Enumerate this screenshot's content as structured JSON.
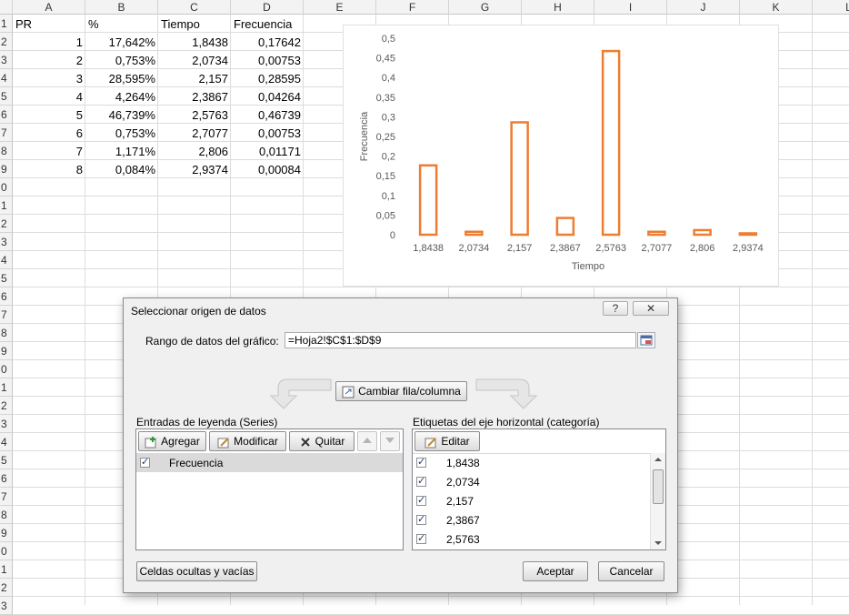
{
  "sheet": {
    "columns": [
      "A",
      "B",
      "C",
      "D",
      "E",
      "F",
      "G",
      "H",
      "I",
      "J",
      "K",
      "L"
    ],
    "rows": [
      "1",
      "2",
      "3",
      "4",
      "5",
      "6",
      "7",
      "8",
      "9",
      "0",
      "1",
      "2",
      "3",
      "4",
      "5",
      "6",
      "7",
      "8",
      "9",
      "0",
      "1",
      "2",
      "3",
      "4",
      "5",
      "6",
      "7",
      "8",
      "9",
      "0",
      "1",
      "2",
      "3"
    ],
    "headers": [
      "PR",
      "%",
      "Tiempo",
      "Frecuencia"
    ],
    "data": [
      [
        "1",
        "17,642%",
        "1,8438",
        "0,17642"
      ],
      [
        "2",
        "0,753%",
        "2,0734",
        "0,00753"
      ],
      [
        "3",
        "28,595%",
        "2,157",
        "0,28595"
      ],
      [
        "4",
        "4,264%",
        "2,3867",
        "0,04264"
      ],
      [
        "5",
        "46,739%",
        "2,5763",
        "0,46739"
      ],
      [
        "6",
        "0,753%",
        "2,7077",
        "0,00753"
      ],
      [
        "7",
        "1,171%",
        "2,806",
        "0,01171"
      ],
      [
        "8",
        "0,084%",
        "2,9374",
        "0,00084"
      ]
    ]
  },
  "chart_data": {
    "type": "bar",
    "categories": [
      "1,8438",
      "2,0734",
      "2,157",
      "2,3867",
      "2,5763",
      "2,7077",
      "2,806",
      "2,9374"
    ],
    "series": [
      {
        "name": "Frecuencia",
        "values": [
          0.17642,
          0.00753,
          0.28595,
          0.04264,
          0.46739,
          0.00753,
          0.01171,
          0.00084
        ]
      }
    ],
    "ytick_labels": [
      "0",
      "0,05",
      "0,1",
      "0,15",
      "0,2",
      "0,25",
      "0,3",
      "0,35",
      "0,4",
      "0,45",
      "0,5"
    ],
    "ylim": [
      0,
      0.5
    ],
    "xlabel": "Tiempo",
    "ylabel": "Frecuencia",
    "title": "",
    "grid": false,
    "bar_color": "#ed7d31"
  },
  "dialog": {
    "title": "Seleccionar origen de datos",
    "help_label": "?",
    "close_label": "✕",
    "range_label": "Rango de datos del gráfico:",
    "range_value": "=Hoja2!$C$1:$D$9",
    "switch_label": "Cambiar fila/columna",
    "legend_title": "Entradas de leyenda (Series)",
    "add_label": "Agregar",
    "edit_label": "Modificar",
    "remove_label": "Quitar",
    "series": [
      {
        "name": "Frecuencia"
      }
    ],
    "axis_title": "Etiquetas del eje horizontal (categoría)",
    "axis_edit_label": "Editar",
    "categories": [
      "1,8438",
      "2,0734",
      "2,157",
      "2,3867",
      "2,5763"
    ],
    "hidden_cells_label": "Celdas ocultas y vacías",
    "ok_label": "Aceptar",
    "cancel_label": "Cancelar"
  }
}
